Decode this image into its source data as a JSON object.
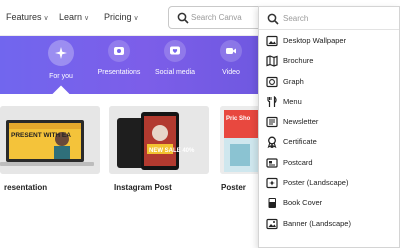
{
  "nav": {
    "items": [
      {
        "label": "Features"
      },
      {
        "label": "Learn"
      },
      {
        "label": "Pricing"
      }
    ],
    "search_placeholder": "Search Canva"
  },
  "hero": {
    "categories": [
      {
        "label": "For you",
        "icon": "sparkle-icon",
        "active": true
      },
      {
        "label": "Presentations",
        "icon": "presentation-icon",
        "active": false
      },
      {
        "label": "Social media",
        "icon": "heart-chat-icon",
        "active": false
      },
      {
        "label": "Video",
        "icon": "video-camera-icon",
        "active": false
      }
    ]
  },
  "templates": [
    {
      "label": "resentation",
      "thumb_text": "PRESENT WITH EA"
    },
    {
      "label": "Instagram Post",
      "thumb_text": "NEW SALE 40%"
    },
    {
      "label": "Poster",
      "thumb_text": "Pric Sho"
    }
  ],
  "dropdown": {
    "search_placeholder": "Search",
    "items": [
      {
        "label": "Desktop Wallpaper",
        "icon": "wallpaper-icon"
      },
      {
        "label": "Brochure",
        "icon": "brochure-icon"
      },
      {
        "label": "Graph",
        "icon": "graph-icon"
      },
      {
        "label": "Menu",
        "icon": "menu-utensils-icon"
      },
      {
        "label": "Newsletter",
        "icon": "newsletter-icon"
      },
      {
        "label": "Certificate",
        "icon": "certificate-icon"
      },
      {
        "label": "Postcard",
        "icon": "postcard-icon"
      },
      {
        "label": "Poster (Landscape)",
        "icon": "poster-landscape-icon"
      },
      {
        "label": "Book Cover",
        "icon": "book-cover-icon"
      },
      {
        "label": "Banner (Landscape)",
        "icon": "banner-landscape-icon"
      }
    ]
  },
  "colors": {
    "hero": "#7464ec",
    "accent_red": "#e8483f",
    "accent_yellow": "#f2c230"
  }
}
